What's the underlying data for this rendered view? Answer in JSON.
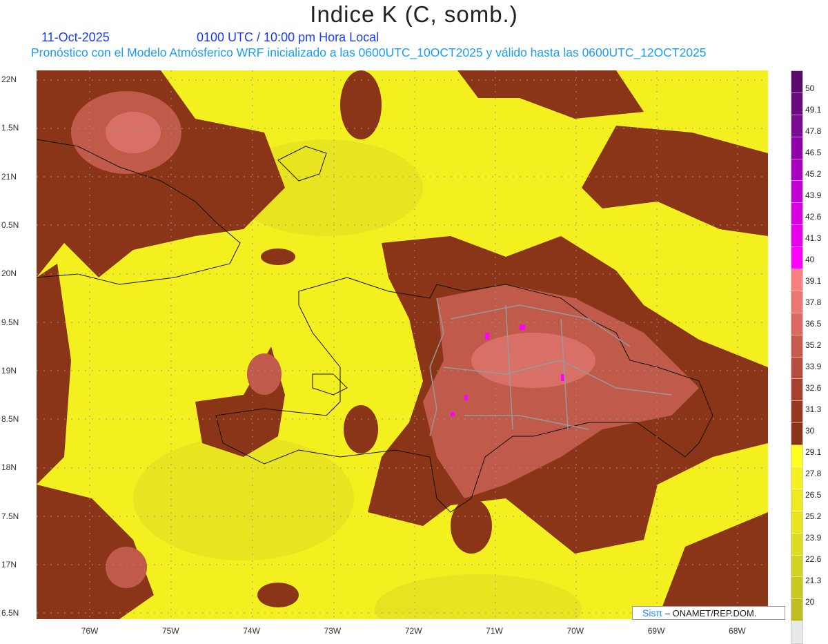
{
  "title": "Indice K (C, somb.)",
  "date": "11-Oct-2025",
  "time": "0100 UTC / 10:00 pm Hora Local",
  "description": "Pronóstico con el Modelo Atmósferico WRF inicializado a las 0600UTC_10OCT2025 y válido hasta las  0600UTC_12OCT2025",
  "lat_labels": [
    "22N",
    "1.5N",
    "21N",
    "0.5N",
    "20N",
    "9.5N",
    "19N",
    "8.5N",
    "18N",
    "7.5N",
    "17N",
    "6.5N"
  ],
  "lon_labels": [
    "76W",
    "75W",
    "74W",
    "73W",
    "72W",
    "71W",
    "70W",
    "69W",
    "68W"
  ],
  "colorbar": {
    "labels": [
      "50",
      "49.1",
      "47.8",
      "46.5",
      "45.2",
      "43.9",
      "42.6",
      "41.3",
      "40",
      "39.1",
      "37.8",
      "36.5",
      "35.2",
      "33.9",
      "32.6",
      "31.3",
      "30",
      "29.1",
      "27.8",
      "26.5",
      "25.2",
      "23.9",
      "22.6",
      "21.3",
      "20"
    ],
    "colors": [
      "#5a0a6a",
      "#6a0a7e",
      "#7a0a92",
      "#9000aa",
      "#a800c0",
      "#c000d4",
      "#d800e0",
      "#e800ec",
      "#ff00ff",
      "#f88080",
      "#ee7672",
      "#dc6a62",
      "#c85a4e",
      "#b84c3e",
      "#a84030",
      "#983820",
      "#8a3418",
      "#ffff20",
      "#f6f020",
      "#eeea20",
      "#e8e420",
      "#dcdc20",
      "#d2d220",
      "#c8c820",
      "#bebe20",
      "#e8e8e8"
    ]
  },
  "credit": {
    "logo": "Sisπ",
    "text": "– ONAMET/REP.DOM."
  }
}
